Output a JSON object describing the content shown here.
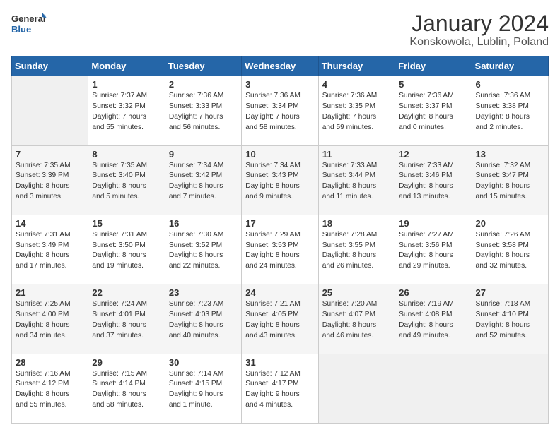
{
  "logo": {
    "line1": "General",
    "line2": "Blue"
  },
  "title": "January 2024",
  "subtitle": "Konskowola, Lublin, Poland",
  "days_header": [
    "Sunday",
    "Monday",
    "Tuesday",
    "Wednesday",
    "Thursday",
    "Friday",
    "Saturday"
  ],
  "weeks": [
    [
      {
        "day": "",
        "empty": true
      },
      {
        "day": "1",
        "sunrise": "Sunrise: 7:37 AM",
        "sunset": "Sunset: 3:32 PM",
        "daylight": "Daylight: 7 hours",
        "daylight2": "and 55 minutes."
      },
      {
        "day": "2",
        "sunrise": "Sunrise: 7:36 AM",
        "sunset": "Sunset: 3:33 PM",
        "daylight": "Daylight: 7 hours",
        "daylight2": "and 56 minutes."
      },
      {
        "day": "3",
        "sunrise": "Sunrise: 7:36 AM",
        "sunset": "Sunset: 3:34 PM",
        "daylight": "Daylight: 7 hours",
        "daylight2": "and 58 minutes."
      },
      {
        "day": "4",
        "sunrise": "Sunrise: 7:36 AM",
        "sunset": "Sunset: 3:35 PM",
        "daylight": "Daylight: 7 hours",
        "daylight2": "and 59 minutes."
      },
      {
        "day": "5",
        "sunrise": "Sunrise: 7:36 AM",
        "sunset": "Sunset: 3:37 PM",
        "daylight": "Daylight: 8 hours",
        "daylight2": "and 0 minutes."
      },
      {
        "day": "6",
        "sunrise": "Sunrise: 7:36 AM",
        "sunset": "Sunset: 3:38 PM",
        "daylight": "Daylight: 8 hours",
        "daylight2": "and 2 minutes."
      }
    ],
    [
      {
        "day": "7",
        "sunrise": "Sunrise: 7:35 AM",
        "sunset": "Sunset: 3:39 PM",
        "daylight": "Daylight: 8 hours",
        "daylight2": "and 3 minutes."
      },
      {
        "day": "8",
        "sunrise": "Sunrise: 7:35 AM",
        "sunset": "Sunset: 3:40 PM",
        "daylight": "Daylight: 8 hours",
        "daylight2": "and 5 minutes."
      },
      {
        "day": "9",
        "sunrise": "Sunrise: 7:34 AM",
        "sunset": "Sunset: 3:42 PM",
        "daylight": "Daylight: 8 hours",
        "daylight2": "and 7 minutes."
      },
      {
        "day": "10",
        "sunrise": "Sunrise: 7:34 AM",
        "sunset": "Sunset: 3:43 PM",
        "daylight": "Daylight: 8 hours",
        "daylight2": "and 9 minutes."
      },
      {
        "day": "11",
        "sunrise": "Sunrise: 7:33 AM",
        "sunset": "Sunset: 3:44 PM",
        "daylight": "Daylight: 8 hours",
        "daylight2": "and 11 minutes."
      },
      {
        "day": "12",
        "sunrise": "Sunrise: 7:33 AM",
        "sunset": "Sunset: 3:46 PM",
        "daylight": "Daylight: 8 hours",
        "daylight2": "and 13 minutes."
      },
      {
        "day": "13",
        "sunrise": "Sunrise: 7:32 AM",
        "sunset": "Sunset: 3:47 PM",
        "daylight": "Daylight: 8 hours",
        "daylight2": "and 15 minutes."
      }
    ],
    [
      {
        "day": "14",
        "sunrise": "Sunrise: 7:31 AM",
        "sunset": "Sunset: 3:49 PM",
        "daylight": "Daylight: 8 hours",
        "daylight2": "and 17 minutes."
      },
      {
        "day": "15",
        "sunrise": "Sunrise: 7:31 AM",
        "sunset": "Sunset: 3:50 PM",
        "daylight": "Daylight: 8 hours",
        "daylight2": "and 19 minutes."
      },
      {
        "day": "16",
        "sunrise": "Sunrise: 7:30 AM",
        "sunset": "Sunset: 3:52 PM",
        "daylight": "Daylight: 8 hours",
        "daylight2": "and 22 minutes."
      },
      {
        "day": "17",
        "sunrise": "Sunrise: 7:29 AM",
        "sunset": "Sunset: 3:53 PM",
        "daylight": "Daylight: 8 hours",
        "daylight2": "and 24 minutes."
      },
      {
        "day": "18",
        "sunrise": "Sunrise: 7:28 AM",
        "sunset": "Sunset: 3:55 PM",
        "daylight": "Daylight: 8 hours",
        "daylight2": "and 26 minutes."
      },
      {
        "day": "19",
        "sunrise": "Sunrise: 7:27 AM",
        "sunset": "Sunset: 3:56 PM",
        "daylight": "Daylight: 8 hours",
        "daylight2": "and 29 minutes."
      },
      {
        "day": "20",
        "sunrise": "Sunrise: 7:26 AM",
        "sunset": "Sunset: 3:58 PM",
        "daylight": "Daylight: 8 hours",
        "daylight2": "and 32 minutes."
      }
    ],
    [
      {
        "day": "21",
        "sunrise": "Sunrise: 7:25 AM",
        "sunset": "Sunset: 4:00 PM",
        "daylight": "Daylight: 8 hours",
        "daylight2": "and 34 minutes."
      },
      {
        "day": "22",
        "sunrise": "Sunrise: 7:24 AM",
        "sunset": "Sunset: 4:01 PM",
        "daylight": "Daylight: 8 hours",
        "daylight2": "and 37 minutes."
      },
      {
        "day": "23",
        "sunrise": "Sunrise: 7:23 AM",
        "sunset": "Sunset: 4:03 PM",
        "daylight": "Daylight: 8 hours",
        "daylight2": "and 40 minutes."
      },
      {
        "day": "24",
        "sunrise": "Sunrise: 7:21 AM",
        "sunset": "Sunset: 4:05 PM",
        "daylight": "Daylight: 8 hours",
        "daylight2": "and 43 minutes."
      },
      {
        "day": "25",
        "sunrise": "Sunrise: 7:20 AM",
        "sunset": "Sunset: 4:07 PM",
        "daylight": "Daylight: 8 hours",
        "daylight2": "and 46 minutes."
      },
      {
        "day": "26",
        "sunrise": "Sunrise: 7:19 AM",
        "sunset": "Sunset: 4:08 PM",
        "daylight": "Daylight: 8 hours",
        "daylight2": "and 49 minutes."
      },
      {
        "day": "27",
        "sunrise": "Sunrise: 7:18 AM",
        "sunset": "Sunset: 4:10 PM",
        "daylight": "Daylight: 8 hours",
        "daylight2": "and 52 minutes."
      }
    ],
    [
      {
        "day": "28",
        "sunrise": "Sunrise: 7:16 AM",
        "sunset": "Sunset: 4:12 PM",
        "daylight": "Daylight: 8 hours",
        "daylight2": "and 55 minutes."
      },
      {
        "day": "29",
        "sunrise": "Sunrise: 7:15 AM",
        "sunset": "Sunset: 4:14 PM",
        "daylight": "Daylight: 8 hours",
        "daylight2": "and 58 minutes."
      },
      {
        "day": "30",
        "sunrise": "Sunrise: 7:14 AM",
        "sunset": "Sunset: 4:15 PM",
        "daylight": "Daylight: 9 hours",
        "daylight2": "and 1 minute."
      },
      {
        "day": "31",
        "sunrise": "Sunrise: 7:12 AM",
        "sunset": "Sunset: 4:17 PM",
        "daylight": "Daylight: 9 hours",
        "daylight2": "and 4 minutes."
      },
      {
        "day": "",
        "empty": true
      },
      {
        "day": "",
        "empty": true
      },
      {
        "day": "",
        "empty": true
      }
    ]
  ]
}
